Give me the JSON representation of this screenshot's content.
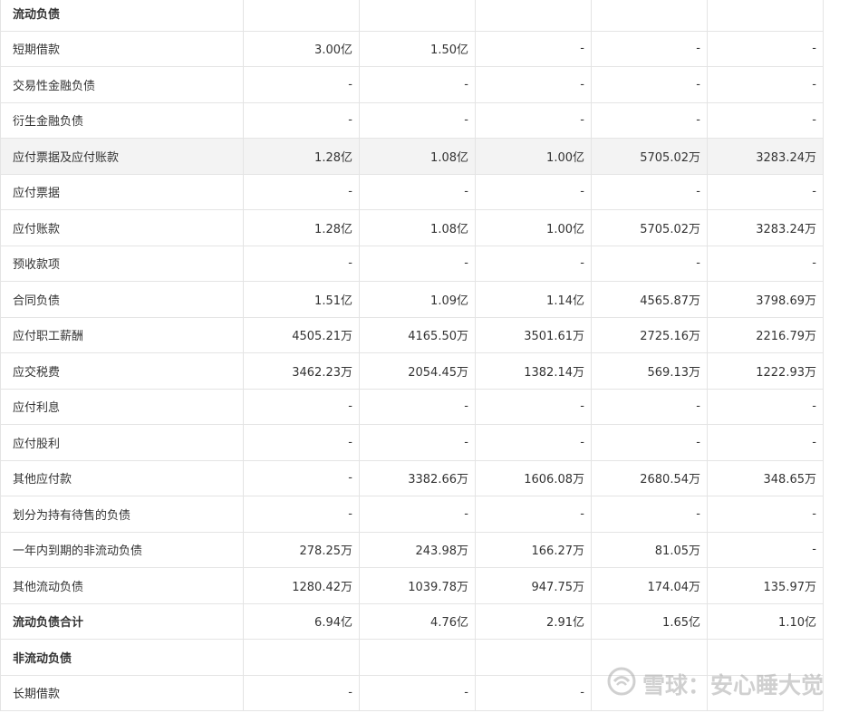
{
  "rows": [
    {
      "label": "流动负债",
      "values": [
        "",
        "",
        "",
        "",
        ""
      ]
    },
    {
      "label": "短期借款",
      "values": [
        "3.00亿",
        "1.50亿",
        "-",
        "-",
        "-"
      ]
    },
    {
      "label": "交易性金融负债",
      "values": [
        "-",
        "-",
        "-",
        "-",
        "-"
      ]
    },
    {
      "label": "衍生金融负债",
      "values": [
        "-",
        "-",
        "-",
        "-",
        "-"
      ]
    },
    {
      "label": "应付票据及应付账款",
      "values": [
        "1.28亿",
        "1.08亿",
        "1.00亿",
        "5705.02万",
        "3283.24万"
      ]
    },
    {
      "label": "应付票据",
      "values": [
        "-",
        "-",
        "-",
        "-",
        "-"
      ]
    },
    {
      "label": "应付账款",
      "values": [
        "1.28亿",
        "1.08亿",
        "1.00亿",
        "5705.02万",
        "3283.24万"
      ]
    },
    {
      "label": "预收款项",
      "values": [
        "-",
        "-",
        "-",
        "-",
        "-"
      ]
    },
    {
      "label": "合同负债",
      "values": [
        "1.51亿",
        "1.09亿",
        "1.14亿",
        "4565.87万",
        "3798.69万"
      ]
    },
    {
      "label": "应付职工薪酬",
      "values": [
        "4505.21万",
        "4165.50万",
        "3501.61万",
        "2725.16万",
        "2216.79万"
      ]
    },
    {
      "label": "应交税费",
      "values": [
        "3462.23万",
        "2054.45万",
        "1382.14万",
        "569.13万",
        "1222.93万"
      ]
    },
    {
      "label": "应付利息",
      "values": [
        "-",
        "-",
        "-",
        "-",
        "-"
      ]
    },
    {
      "label": "应付股利",
      "values": [
        "-",
        "-",
        "-",
        "-",
        "-"
      ]
    },
    {
      "label": "其他应付款",
      "values": [
        "-",
        "3382.66万",
        "1606.08万",
        "2680.54万",
        "348.65万"
      ]
    },
    {
      "label": "划分为持有待售的负债",
      "values": [
        "-",
        "-",
        "-",
        "-",
        "-"
      ]
    },
    {
      "label": "一年内到期的非流动负债",
      "values": [
        "278.25万",
        "243.98万",
        "166.27万",
        "81.05万",
        "-"
      ]
    },
    {
      "label": "其他流动负债",
      "values": [
        "1280.42万",
        "1039.78万",
        "947.75万",
        "174.04万",
        "135.97万"
      ]
    },
    {
      "label": "流动负债合计",
      "values": [
        "6.94亿",
        "4.76亿",
        "2.91亿",
        "1.65亿",
        "1.10亿"
      ]
    },
    {
      "label": "非流动负债",
      "values": [
        "",
        "",
        "",
        "",
        ""
      ]
    },
    {
      "label": "长期借款",
      "values": [
        "-",
        "-",
        "-",
        "",
        ""
      ]
    }
  ],
  "watermark": {
    "text": "雪球：安心睡大觉",
    "icon": "xueqiu-snowball-logo"
  }
}
